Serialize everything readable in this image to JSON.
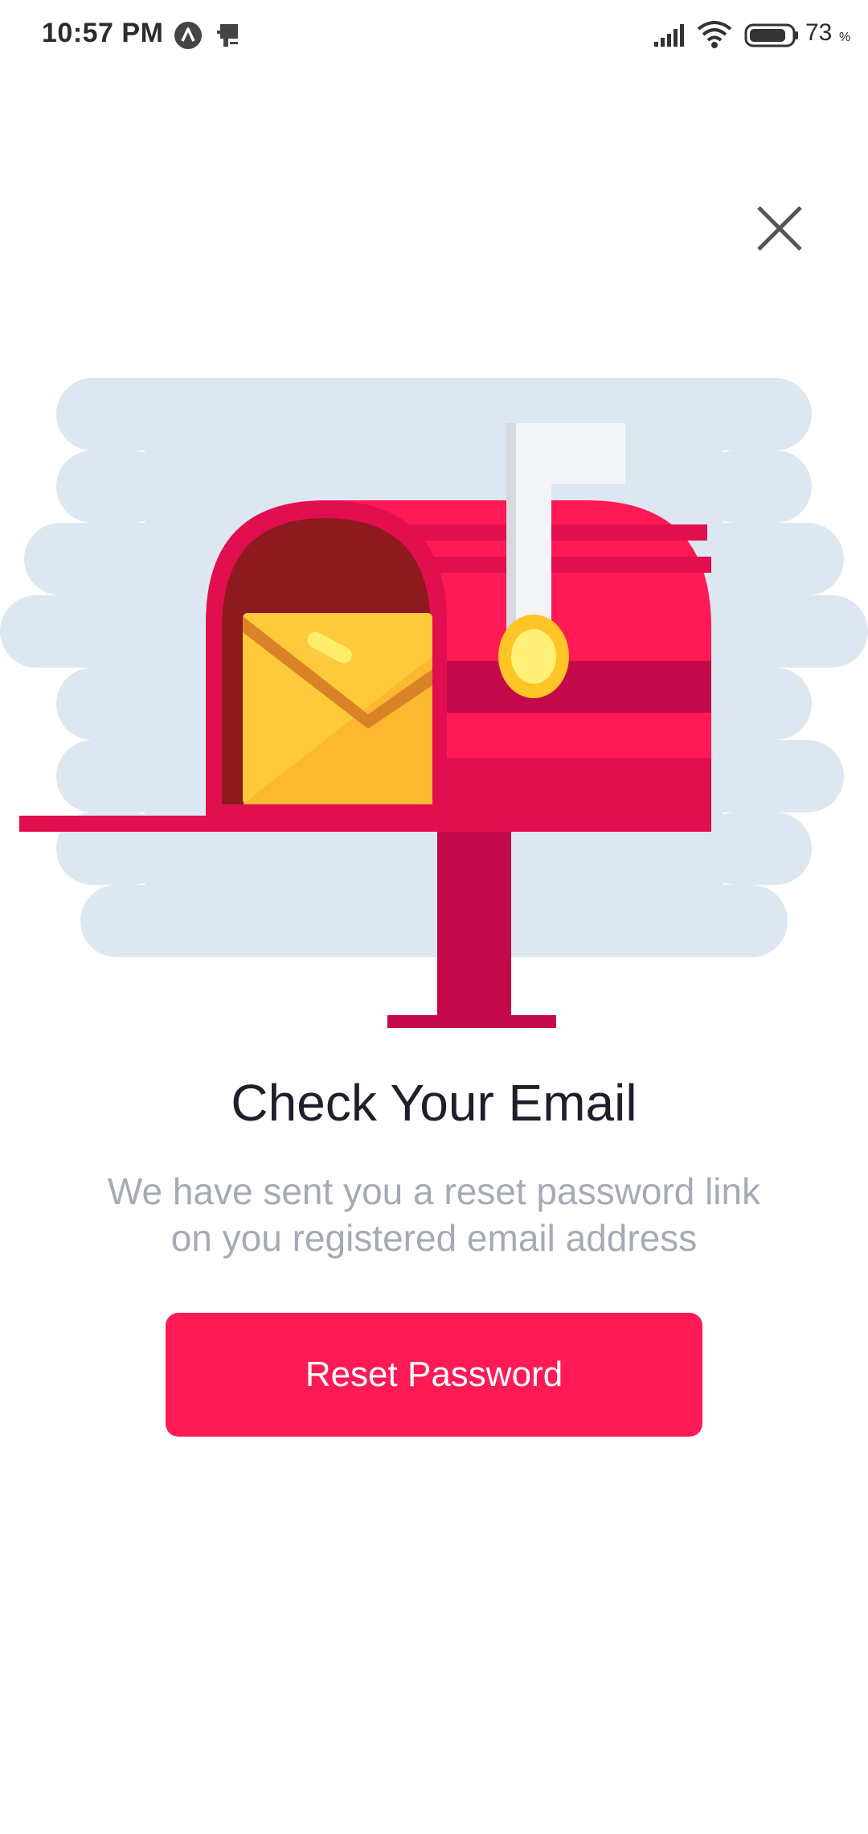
{
  "status_bar": {
    "time": "10:57 PM",
    "battery_level": "73",
    "battery_unit": "%",
    "icons": [
      "app-a-icon",
      "device-icon",
      "signal-icon",
      "wifi-icon",
      "battery-icon"
    ]
  },
  "dialog": {
    "close_icon": "close-icon",
    "illustration": "mailbox-with-envelope-illustration",
    "title": "Check Your Email",
    "message_line1": "We have sent you a reset password link",
    "message_line2": "on you registered email address",
    "button_label": "Reset Password"
  },
  "colors": {
    "accent": "#ff1a55",
    "title_text": "#1f1f2b",
    "muted_text": "#a5aab5",
    "cloud": "#dde7f1",
    "mailbox_red": "#ff1a55",
    "mailbox_dark": "#c4094a",
    "envelope": "#ffc93c"
  }
}
